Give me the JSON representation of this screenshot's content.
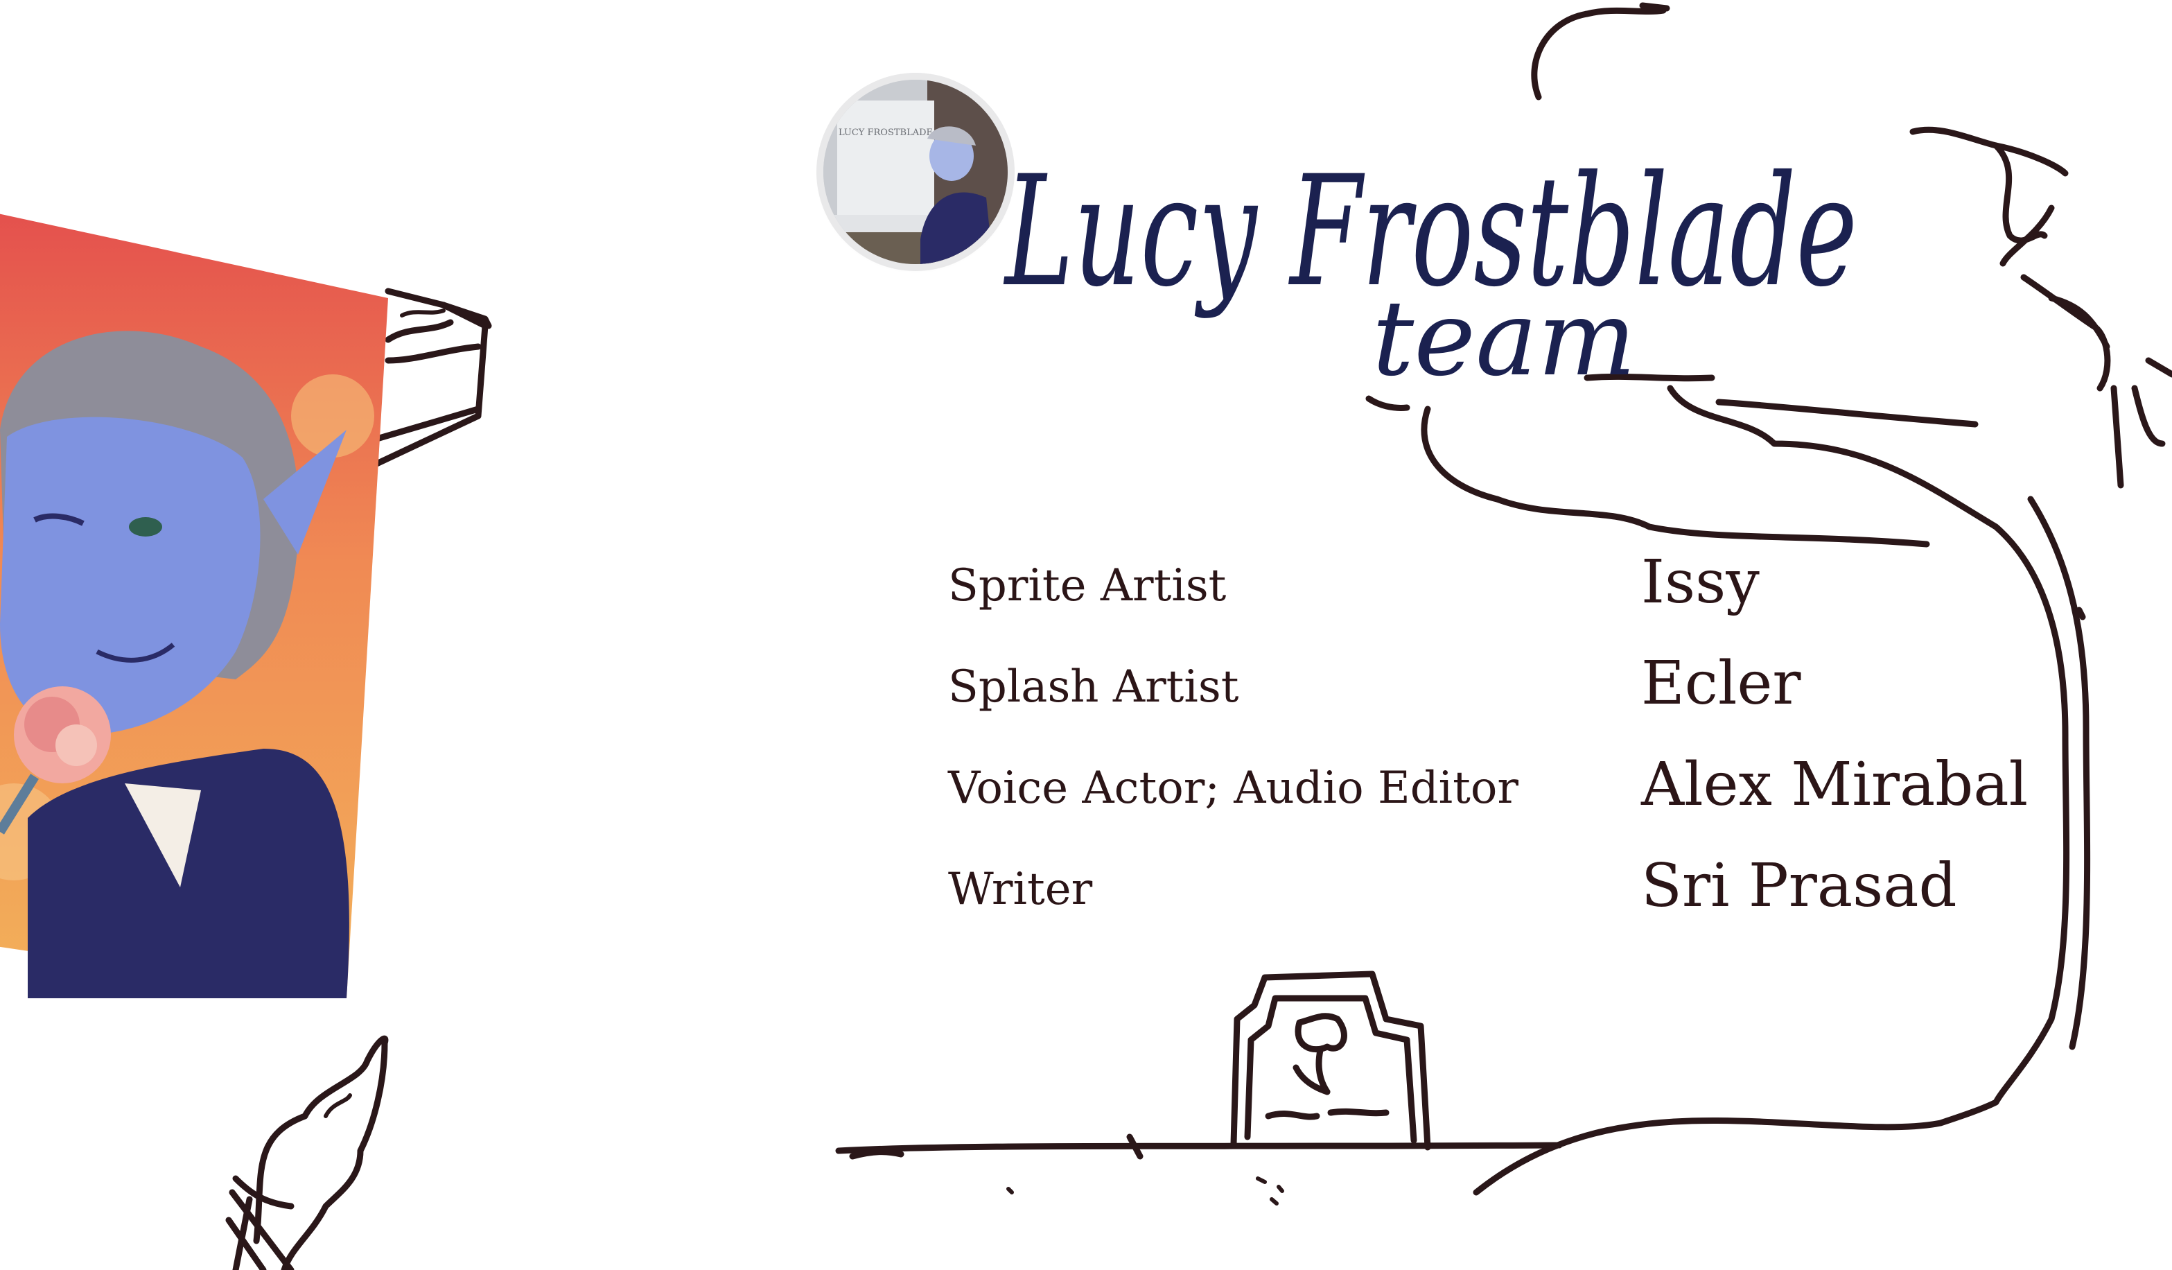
{
  "header": {
    "signature_line1": "Lucy Frostblade",
    "signature_line2": "team"
  },
  "avatar": {
    "gravestone_name": "LUCY FROSTBLADE"
  },
  "credits": [
    {
      "role": "Sprite Artist",
      "name": "Issy"
    },
    {
      "role": "Splash Artist",
      "name": "Ecler"
    },
    {
      "role": "Voice Actor; Audio Editor",
      "name": "Alex Mirabal"
    },
    {
      "role": "Writer",
      "name": "Sri Prasad"
    }
  ],
  "colors": {
    "ink": "#2a1719",
    "signature_ink": "#1b2150",
    "text": "#2b1517",
    "splash_top": "#e4504d",
    "splash_bottom": "#f3b15a",
    "skin": "#7f93e0",
    "sweater": "#2a2b66"
  },
  "icons": [
    "flower-icon",
    "gravestone-icon",
    "ice-cream-icon",
    "cake-slice-icon",
    "tree-icon"
  ]
}
